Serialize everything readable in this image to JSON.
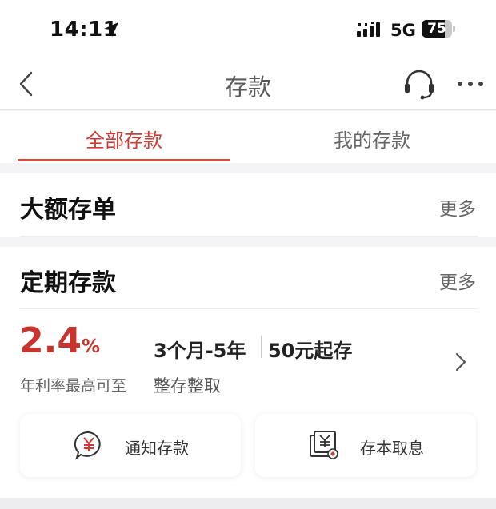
{
  "status_bar": {
    "time": "14:11",
    "network": "5G",
    "battery_level": "75",
    "battery_fraction": 0.75,
    "icons": [
      "location-arrow-icon",
      "signal-icon",
      "battery-icon"
    ]
  },
  "nav": {
    "title": "存款",
    "icons": [
      "back-icon",
      "headset-icon",
      "more-icon"
    ]
  },
  "tabs": [
    {
      "label": "全部存款",
      "active": true
    },
    {
      "label": "我的存款",
      "active": false
    }
  ],
  "large_deposit": {
    "title": "大额存单",
    "more": "更多"
  },
  "fixed_deposit": {
    "title": "定期存款",
    "more": "更多",
    "product": {
      "rate_value": "2.4",
      "rate_unit": "%",
      "rate_caption": "年利率最高可至",
      "term": "3个月-5年",
      "min_amount": "50元起存",
      "type": "整存整取"
    },
    "actions": [
      {
        "label": "通知存款",
        "icon": "yuan-bubble-icon"
      },
      {
        "label": "存本取息",
        "icon": "yuan-card-icon"
      }
    ]
  },
  "colors": {
    "accent": "#d03a33",
    "background": "#f4f4f6",
    "card": "#ffffff"
  }
}
